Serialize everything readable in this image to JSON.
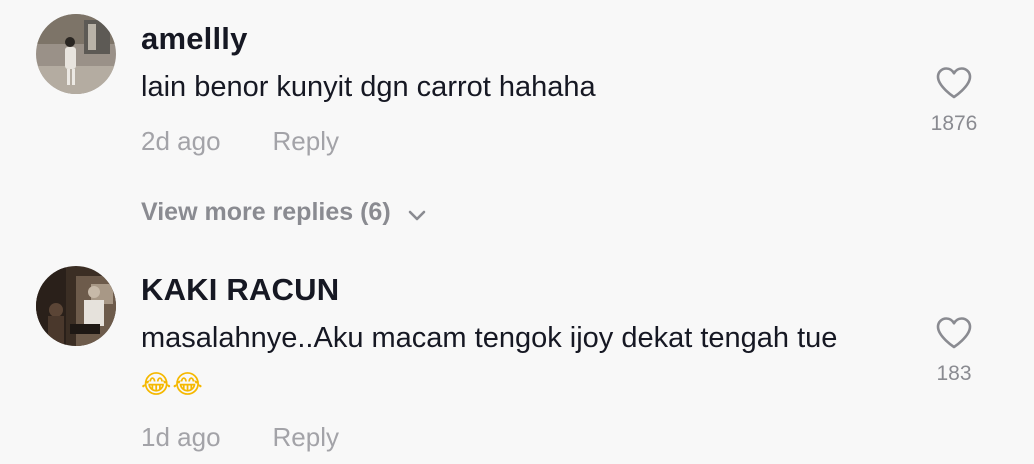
{
  "comments": [
    {
      "username": "amellly",
      "text": "lain benor kunyit dgn carrot hahaha",
      "time": "2d ago",
      "reply_label": "Reply",
      "like_count": "1876",
      "view_more": "View more replies (6)",
      "avatar_icon": "user-avatar-photo"
    },
    {
      "username": "KAKI RACUN",
      "text": "masalahnye..Aku macam tengok ijoy dekat tengah tue",
      "emoji": "😂😂",
      "time": "1d ago",
      "reply_label": "Reply",
      "like_count": "183",
      "avatar_icon": "user-avatar-photo"
    }
  ],
  "colors": {
    "background": "#f8f8f8",
    "primary_text": "#161823",
    "secondary_text": "#a3a3a8",
    "muted_text": "#8a8b91"
  },
  "icons": {
    "like": "heart-outline-icon",
    "expand": "chevron-down-icon"
  }
}
